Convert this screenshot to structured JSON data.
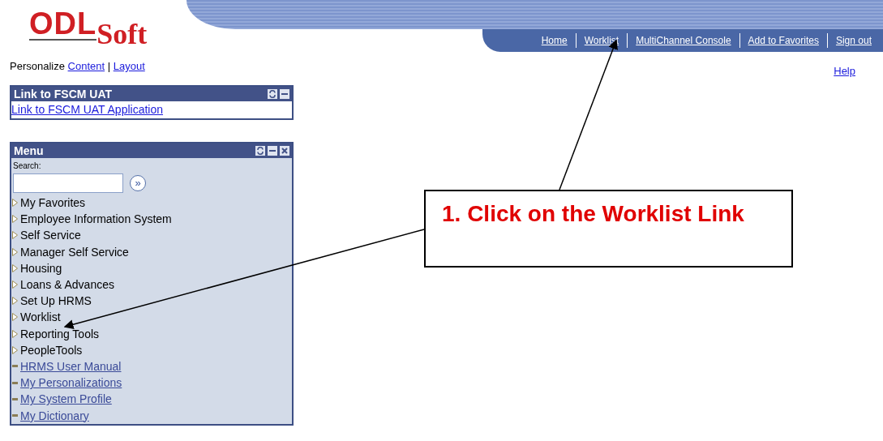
{
  "logo": {
    "main": "ODL",
    "sub": "Soft"
  },
  "nav_links": [
    {
      "label": "Home"
    },
    {
      "label": "Worklist"
    },
    {
      "label": "MultiChannel Console"
    },
    {
      "label": "Add to Favorites"
    },
    {
      "label": "Sign out"
    }
  ],
  "help_link": "Help",
  "personalize": {
    "label": "Personalize",
    "links": [
      "Content",
      "Layout"
    ],
    "separator": "|"
  },
  "link_pagelet": {
    "title": "Link to FSCM UAT",
    "link": "Link to FSCM UAT Application"
  },
  "menu_pagelet": {
    "title": "Menu",
    "search_label": "Search:",
    "search_button": "»",
    "items": [
      {
        "kind": "folder",
        "label": "My Favorites"
      },
      {
        "kind": "folder",
        "label": "Employee Information System"
      },
      {
        "kind": "folder",
        "label": "Self Service"
      },
      {
        "kind": "folder",
        "label": "Manager Self Service"
      },
      {
        "kind": "folder",
        "label": "Housing"
      },
      {
        "kind": "folder",
        "label": "Loans & Advances"
      },
      {
        "kind": "folder",
        "label": "Set Up HRMS"
      },
      {
        "kind": "folder",
        "label": "Worklist"
      },
      {
        "kind": "folder",
        "label": "Reporting Tools"
      },
      {
        "kind": "folder",
        "label": "PeopleTools"
      },
      {
        "kind": "link",
        "label": "HRMS User Manual"
      },
      {
        "kind": "link",
        "label": "My Personalizations"
      },
      {
        "kind": "link",
        "label": "My System Profile"
      },
      {
        "kind": "link",
        "label": "My Dictionary"
      }
    ]
  },
  "callout": {
    "text": "1. Click on the Worklist Link"
  }
}
